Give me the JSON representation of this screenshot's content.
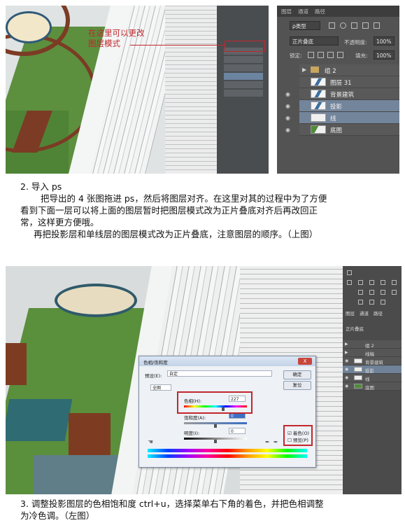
{
  "top_figure": {
    "annotation": "在这里可以更改\n图层模式"
  },
  "layers_panel": {
    "tabs": [
      "图层",
      "通道",
      "路径"
    ],
    "filter_kind": "ρ类型",
    "blend_mode": "正片叠底",
    "opacity_label": "不透明度:",
    "opacity_value": "100%",
    "lock_label": "锁定:",
    "fill_label": "填充:",
    "fill_value": "100%",
    "layers": [
      {
        "name": "组 2",
        "type": "group",
        "visible": false,
        "selected": false
      },
      {
        "name": "图层 31",
        "type": "layer",
        "visible": false,
        "selected": false
      },
      {
        "name": "背景建筑",
        "type": "layer",
        "visible": true,
        "selected": false
      },
      {
        "name": "投影",
        "type": "layer",
        "visible": true,
        "selected": true
      },
      {
        "name": "线",
        "type": "layer",
        "visible": true,
        "selected": true
      },
      {
        "name": "底图",
        "type": "layer",
        "visible": true,
        "selected": false
      }
    ]
  },
  "text_block_1": {
    "heading": "2. 导入 ps",
    "line1": "把导出的 4 张图拖进 ps，然后将图层对齐。在这里对其的过程中为了方便",
    "line2": "看到下面一层可以将上面的图层暂时把图层模式改为正片叠底对齐后再改回正",
    "line3": "常，这样更方便哦。",
    "line4": "再把投影层和单线层的图层模式改为正片叠底，注意图层的顺序。（上图）"
  },
  "bottom_panel": {
    "tabs": [
      "图层",
      "通道",
      "路径"
    ],
    "blend_mode": "正片叠底",
    "layers": [
      {
        "name": "组 2",
        "selected": false
      },
      {
        "name": "线稿",
        "selected": false
      },
      {
        "name": "背景建筑",
        "selected": false
      },
      {
        "name": "投影",
        "selected": true
      },
      {
        "name": "线",
        "selected": false
      },
      {
        "name": "底图",
        "selected": false
      }
    ]
  },
  "hue_dialog": {
    "title": "色相/饱和度",
    "close_label": "X",
    "preset_label": "预设(E):",
    "preset_value": "自定",
    "ok_label": "确定",
    "cancel_label": "复位",
    "range_value": "全图",
    "hue_label": "色相(H):",
    "hue_value": "227",
    "saturation_label": "饱和度(A):",
    "saturation_value": "0",
    "lightness_label": "明度(I):",
    "lightness_value": "0",
    "colorize_label": "着色(O)",
    "preview_label": "预览(P)",
    "colorize_checked": true,
    "preview_checked": false
  },
  "text_block_2": {
    "line1": "3. 调整投影图层的色相饱和度 ctrl+u，选择菜单右下角的着色，并把色相调整",
    "line2": "为冷色调。（左图）"
  }
}
